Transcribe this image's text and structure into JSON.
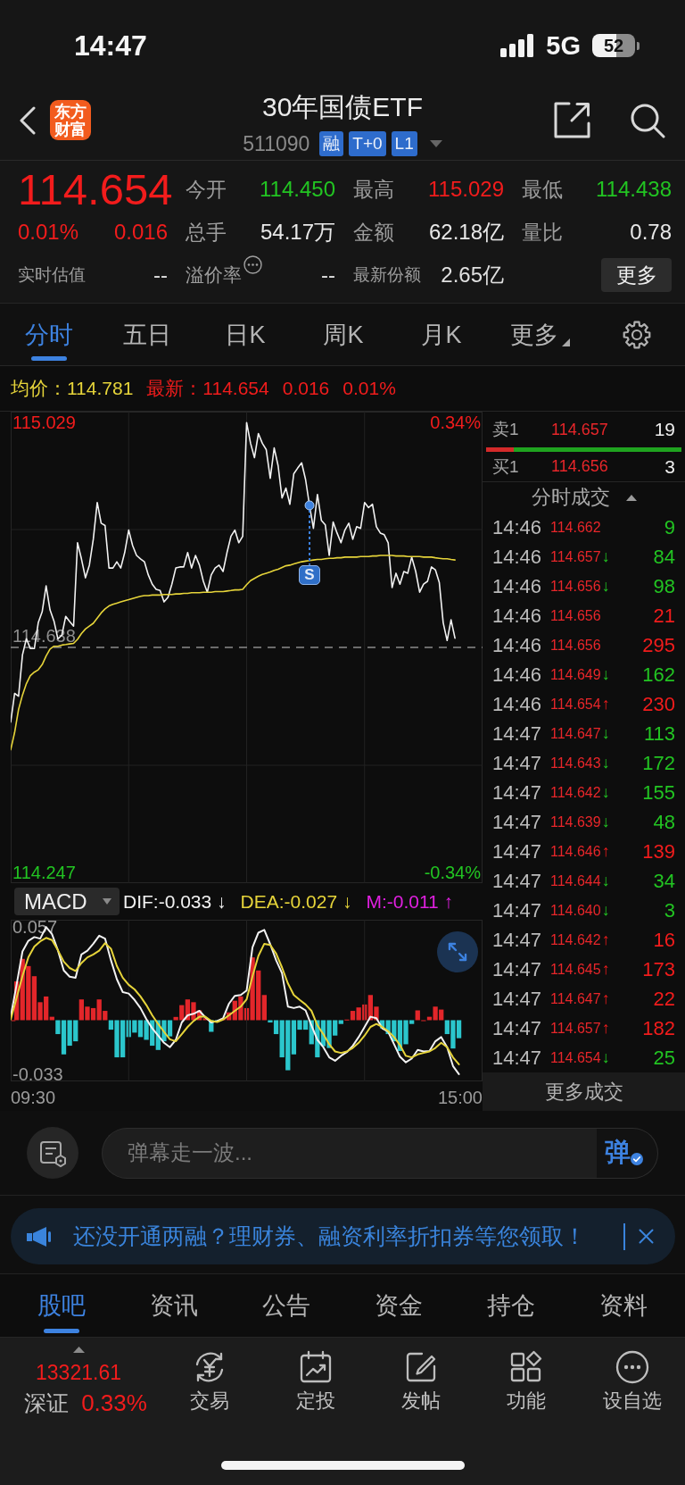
{
  "status_bar": {
    "time": "14:47",
    "network": "5G",
    "battery": "52"
  },
  "header": {
    "logo_lines": [
      "东方",
      "财富"
    ],
    "title": "30年国债ETF",
    "code": "511090",
    "tags": [
      "融",
      "T+0",
      "L1"
    ]
  },
  "quote": {
    "price": "114.654",
    "change_pct": "0.01%",
    "change": "0.016",
    "color": "#f21c1c",
    "stats": [
      {
        "label": "今开",
        "value": "114.450",
        "color": "#22c422"
      },
      {
        "label": "最高",
        "value": "115.029",
        "color": "#f21c1c"
      },
      {
        "label": "最低",
        "value": "114.438",
        "color": "#22c422"
      },
      {
        "label": "总手",
        "value": "54.17万",
        "color": "#e8e8e8"
      },
      {
        "label": "金额",
        "value": "62.18亿",
        "color": "#e8e8e8"
      },
      {
        "label": "量比",
        "value": "0.78",
        "color": "#e8e8e8"
      }
    ],
    "extras": [
      {
        "label": "实时估值",
        "value": "--",
        "tip": false
      },
      {
        "label": "溢价率",
        "value": "--",
        "tip": true
      },
      {
        "label": "最新份额",
        "value": "2.65亿",
        "tip": false
      }
    ],
    "more_button": "更多"
  },
  "tabs": [
    {
      "label": "分时",
      "selected": true,
      "dropdown": false
    },
    {
      "label": "五日",
      "selected": false,
      "dropdown": false
    },
    {
      "label": "日K",
      "selected": false,
      "dropdown": false
    },
    {
      "label": "周K",
      "selected": false,
      "dropdown": false
    },
    {
      "label": "月K",
      "selected": false,
      "dropdown": false
    },
    {
      "label": "更多",
      "selected": false,
      "dropdown": true
    }
  ],
  "legend": [
    {
      "text": "均价：114.781",
      "color": "#e6d43a"
    },
    {
      "text": "最新：114.654",
      "color": "#f21c1c"
    },
    {
      "text": "0.016",
      "color": "#f21c1c"
    },
    {
      "text": "0.01%",
      "color": "#f21c1c"
    }
  ],
  "price_chart": {
    "right_labels": [
      {
        "text": "0.34%",
        "color": "#f21c1c"
      },
      {
        "text": "-0.34%",
        "color": "#22c422"
      }
    ],
    "chart_data": {
      "type": "line",
      "grid": true,
      "ylim": [
        114.228,
        115.048
      ],
      "yticks": [
        {
          "value": 115.029,
          "label": "115.029"
        },
        {
          "value": 114.247,
          "label": "114.247"
        }
      ],
      "ref_lines": [
        {
          "axis": "y",
          "value": 114.638,
          "label": "114.638"
        }
      ],
      "annotations": [
        {
          "y": 114.885,
          "text": "S"
        }
      ],
      "categories": [
        null,
        null,
        null,
        null,
        null,
        null,
        null,
        null,
        null,
        null,
        null,
        null,
        null,
        null,
        null,
        null,
        null,
        null,
        null,
        null,
        null,
        null,
        null,
        null,
        null,
        null,
        null,
        null,
        null,
        null,
        null,
        null,
        null,
        null,
        null,
        null,
        null,
        null,
        null,
        null,
        null,
        null,
        null,
        null,
        null,
        null,
        null,
        null,
        null,
        null,
        null,
        null,
        null,
        null,
        null,
        null,
        null,
        null,
        null,
        null,
        null,
        null,
        null,
        null,
        null,
        null,
        null,
        null,
        null,
        null,
        null,
        null,
        null,
        null,
        null,
        null,
        null,
        null,
        null,
        null,
        null,
        null,
        null,
        null,
        null,
        null,
        null,
        null,
        null,
        null,
        null,
        null,
        null,
        null,
        null,
        null,
        null,
        null,
        null,
        null,
        null,
        null,
        null,
        null,
        null,
        null,
        null,
        null,
        null,
        null,
        null,
        null,
        null,
        null,
        null,
        null,
        null,
        null,
        null,
        null,
        null
      ],
      "series": [
        {
          "color": "#f2f2f2",
          "values": [
            114.508,
            114.558,
            114.553,
            114.625,
            114.653,
            114.636,
            114.636,
            114.681,
            114.7,
            114.745,
            114.703,
            114.684,
            114.653,
            114.659,
            114.692,
            114.683,
            114.675,
            114.82,
            114.792,
            114.759,
            114.781,
            114.826,
            114.89,
            114.854,
            114.85,
            114.776,
            114.776,
            114.787,
            114.776,
            114.803,
            114.842,
            114.815,
            114.798,
            114.792,
            114.787,
            114.764,
            114.748,
            114.739,
            114.737,
            114.717,
            114.725,
            114.748,
            114.776,
            114.778,
            114.778,
            114.803,
            114.776,
            114.798,
            114.781,
            114.753,
            114.734,
            114.764,
            114.776,
            114.781,
            114.77,
            114.803,
            114.831,
            114.842,
            114.82,
            114.831,
            115.029,
            114.993,
            114.968,
            115.01,
            114.993,
            114.982,
            114.932,
            114.985,
            114.954,
            114.898,
            114.915,
            114.887,
            114.94,
            114.95,
            114.959,
            114.93,
            114.885,
            114.845,
            114.904,
            114.859,
            114.851,
            114.798,
            114.856,
            114.837,
            114.82,
            114.842,
            114.854,
            114.826,
            114.848,
            114.845,
            114.89,
            114.881,
            114.887,
            114.848,
            114.837,
            114.834,
            114.82,
            114.742,
            114.767,
            114.748,
            114.77,
            114.767,
            114.795,
            114.77,
            114.734,
            114.748,
            114.753,
            114.778,
            114.773,
            114.751,
            114.681,
            114.65,
            114.686,
            114.654,
            null,
            null,
            null,
            null,
            null,
            null,
            null
          ]
        },
        {
          "color": "#e6d43a",
          "values": [
            114.46,
            114.49,
            114.53,
            114.555,
            114.575,
            114.589,
            114.595,
            114.599,
            114.608,
            114.623,
            114.635,
            114.64,
            114.64,
            114.642,
            114.643,
            114.644,
            114.645,
            114.652,
            114.662,
            114.67,
            114.675,
            114.68,
            114.689,
            114.698,
            114.705,
            114.71,
            114.713,
            114.715,
            114.717,
            114.719,
            114.721,
            114.723,
            114.725,
            114.727,
            114.728,
            114.728,
            114.729,
            114.729,
            114.729,
            114.73,
            114.73,
            114.73,
            114.731,
            114.731,
            114.732,
            114.732,
            114.733,
            114.733,
            114.733,
            114.734,
            114.734,
            114.734,
            114.735,
            114.735,
            114.735,
            114.736,
            114.737,
            114.738,
            114.738,
            114.739,
            114.747,
            114.754,
            114.758,
            114.762,
            114.765,
            114.767,
            114.769,
            114.772,
            114.774,
            114.777,
            114.78,
            114.781,
            114.783,
            114.785,
            114.787,
            114.788,
            114.789,
            114.79,
            114.791,
            114.791,
            114.792,
            114.793,
            114.793,
            114.794,
            114.794,
            114.795,
            114.795,
            114.795,
            114.795,
            114.796,
            114.796,
            114.796,
            114.797,
            114.797,
            114.798,
            114.798,
            114.798,
            114.798,
            114.797,
            114.797,
            114.797,
            114.796,
            114.796,
            114.796,
            114.796,
            114.795,
            114.795,
            114.795,
            114.794,
            114.793,
            114.792,
            114.792,
            114.791,
            114.79,
            null,
            null,
            null,
            null,
            null,
            null,
            null
          ]
        }
      ]
    }
  },
  "macd": {
    "selector": "MACD",
    "indicators": [
      {
        "text": "DIF:-0.033 ↓",
        "color": "#f2f2f2"
      },
      {
        "text": "DEA:-0.027 ↓",
        "color": "#e6d43a"
      },
      {
        "text": "M:-0.011 ↑",
        "color": "#e020e0"
      }
    ],
    "chart_data": {
      "type": "line",
      "grid": true,
      "ylim": [
        -0.0374,
        0.0614
      ],
      "yticks": [
        {
          "value": 0.057,
          "label": "0.057"
        },
        {
          "value": -0.033,
          "label": "-0.033"
        }
      ],
      "categories": [
        null,
        null,
        null,
        null,
        null,
        null,
        null,
        null,
        null,
        null,
        null,
        null,
        null,
        null,
        null,
        null,
        null,
        null,
        null,
        null,
        null,
        null,
        null,
        null,
        null,
        null,
        null,
        null,
        null,
        null,
        null,
        null,
        null,
        null,
        null,
        null,
        null,
        null,
        null,
        null,
        null,
        null,
        null,
        null,
        null,
        null,
        null,
        null,
        null,
        null,
        null,
        null,
        null,
        null,
        null,
        null,
        null,
        null,
        null,
        null,
        null,
        null,
        null,
        null,
        null,
        null,
        null,
        null,
        null,
        null,
        null,
        null,
        null,
        null,
        null,
        null,
        null,
        null,
        null,
        null,
        null
      ],
      "series": [
        {
          "color": "#f2f2f2",
          "values": [
            0.0021,
            0.0216,
            0.042,
            0.0485,
            0.0508,
            0.0499,
            0.057,
            0.0526,
            0.0428,
            0.0304,
            0.0266,
            0.026,
            0.0402,
            0.0425,
            0.0467,
            0.0517,
            0.0499,
            0.0366,
            0.0251,
            0.0172,
            0.0163,
            0.0124,
            0.0074,
            0.0007,
            -0.005,
            -0.0094,
            -0.0138,
            -0.0165,
            -0.012,
            -0.0014,
            0.003,
            0.0039,
            0.0057,
            0.0018,
            -0.0014,
            -0.0005,
            0.0012,
            0.0101,
            0.0149,
            0.0154,
            0.0181,
            0.0446,
            0.0535,
            0.0552,
            0.0464,
            0.0366,
            0.0287,
            0.0083,
            0.0074,
            0.0083,
            0.006,
            -0.0032,
            -0.012,
            -0.0165,
            -0.0227,
            -0.0248,
            -0.0218,
            -0.0195,
            -0.0156,
            -0.0103,
            -0.0041,
            0.0021,
            0.0012,
            -0.005,
            -0.0071,
            -0.0147,
            -0.0223,
            -0.0258,
            -0.0235,
            -0.0182,
            -0.0191,
            -0.0188,
            -0.0129,
            -0.0103,
            -0.0165,
            -0.028,
            -0.033,
            null,
            null,
            null,
            null
          ]
        },
        {
          "color": "#e6d43a",
          "values": [
            0.0004,
            0.0136,
            0.027,
            0.0384,
            0.045,
            0.0482,
            0.0503,
            0.049,
            0.0428,
            0.0358,
            0.0319,
            0.0301,
            0.0349,
            0.0384,
            0.0402,
            0.0425,
            0.0471,
            0.0437,
            0.0331,
            0.026,
            0.0216,
            0.0188,
            0.0145,
            0.0092,
            0.003,
            -0.0023,
            -0.0071,
            -0.0117,
            -0.0129,
            -0.0085,
            -0.0041,
            -0.0005,
            0.0021,
            0.0021,
            -0.0004,
            -0.0011,
            0.0004,
            0.003,
            0.0057,
            0.0083,
            0.0127,
            0.0269,
            0.0393,
            0.0467,
            0.046,
            0.0407,
            0.0322,
            0.0225,
            0.0154,
            0.0124,
            0.0096,
            0.0057,
            -0.0032,
            -0.0085,
            -0.0147,
            -0.0191,
            -0.02,
            -0.0191,
            -0.017,
            -0.0138,
            -0.0094,
            -0.0041,
            -0.0023,
            -0.0041,
            -0.0067,
            -0.0103,
            -0.0152,
            -0.0218,
            -0.0227,
            -0.0209,
            -0.02,
            -0.0191,
            -0.017,
            -0.0138,
            -0.0165,
            -0.0227,
            -0.027,
            null,
            null,
            null,
            null
          ]
        }
      ]
    },
    "time_labels": [
      "09:30",
      "15:00"
    ]
  },
  "order_book": {
    "ask": {
      "label": "卖1",
      "price": "114.657",
      "volume": "19"
    },
    "bid": {
      "label": "买1",
      "price": "114.656",
      "volume": "3"
    },
    "ratio_bar": {
      "level": 0.14
    }
  },
  "trades": {
    "title": "分时成交",
    "rows": [
      {
        "time": "14:46",
        "price": "114.662",
        "volume": "9",
        "color": "#22c422"
      },
      {
        "time": "14:46",
        "price": "114.657",
        "arrow": "↓",
        "volume": "84",
        "color": "#22c422"
      },
      {
        "time": "14:46",
        "price": "114.656",
        "arrow": "↓",
        "volume": "98",
        "color": "#22c422"
      },
      {
        "time": "14:46",
        "price": "114.656",
        "volume": "21",
        "color": "#f21c1c"
      },
      {
        "time": "14:46",
        "price": "114.656",
        "volume": "295",
        "color": "#f21c1c"
      },
      {
        "time": "14:46",
        "price": "114.649",
        "arrow": "↓",
        "volume": "162",
        "color": "#22c422"
      },
      {
        "time": "14:46",
        "price": "114.654",
        "arrow": "↑",
        "volume": "230",
        "color": "#f21c1c"
      },
      {
        "time": "14:47",
        "price": "114.647",
        "arrow": "↓",
        "volume": "113",
        "color": "#22c422"
      },
      {
        "time": "14:47",
        "price": "114.643",
        "arrow": "↓",
        "volume": "172",
        "color": "#22c422"
      },
      {
        "time": "14:47",
        "price": "114.642",
        "arrow": "↓",
        "volume": "155",
        "color": "#22c422"
      },
      {
        "time": "14:47",
        "price": "114.639",
        "arrow": "↓",
        "volume": "48",
        "color": "#22c422"
      },
      {
        "time": "14:47",
        "price": "114.646",
        "arrow": "↑",
        "volume": "139",
        "color": "#f21c1c"
      },
      {
        "time": "14:47",
        "price": "114.644",
        "arrow": "↓",
        "volume": "34",
        "color": "#22c422"
      },
      {
        "time": "14:47",
        "price": "114.640",
        "arrow": "↓",
        "volume": "3",
        "color": "#22c422"
      },
      {
        "time": "14:47",
        "price": "114.642",
        "arrow": "↑",
        "volume": "16",
        "color": "#f21c1c"
      },
      {
        "time": "14:47",
        "price": "114.645",
        "arrow": "↑",
        "volume": "173",
        "color": "#f21c1c"
      },
      {
        "time": "14:47",
        "price": "114.647",
        "arrow": "↑",
        "volume": "22",
        "color": "#f21c1c"
      },
      {
        "time": "14:47",
        "price": "114.657",
        "arrow": "↑",
        "volume": "182",
        "color": "#f21c1c"
      },
      {
        "time": "14:47",
        "price": "114.654",
        "arrow": "↓",
        "volume": "25",
        "color": "#22c422"
      }
    ],
    "more": "更多成交"
  },
  "danmaku": {
    "placeholder": "弹幕走一波...",
    "send_label": "弹"
  },
  "notice": {
    "text": "还没开通两融？理财券、融资利率折扣券等您领取！"
  },
  "bottom_tabs": [
    {
      "label": "股吧",
      "selected": true
    },
    {
      "label": "资讯",
      "selected": false
    },
    {
      "label": "公告",
      "selected": false
    },
    {
      "label": "资金",
      "selected": false
    },
    {
      "label": "持仓",
      "selected": false
    },
    {
      "label": "资料",
      "selected": false
    }
  ],
  "toolbar": {
    "index": {
      "value": "13321.61",
      "name": "深证",
      "change_pct": "0.33%",
      "color": "#f21c1c"
    },
    "items": [
      "交易",
      "定投",
      "发帖",
      "功能",
      "设自选"
    ]
  }
}
